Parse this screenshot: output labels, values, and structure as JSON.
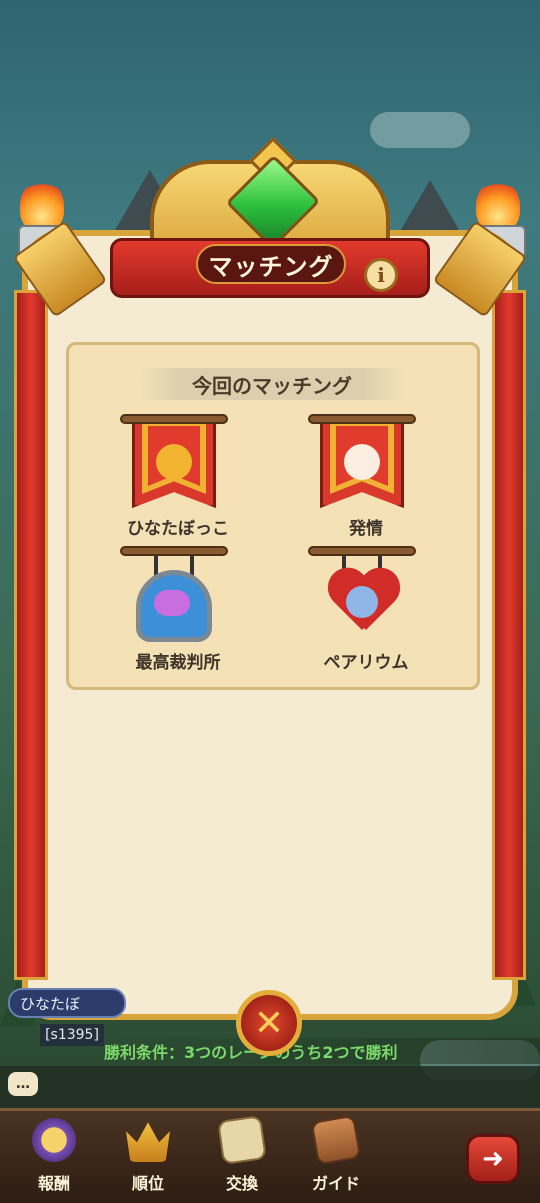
{
  "header": {
    "title": "マッチング",
    "info_icon": "i"
  },
  "card": {
    "subtitle": "今回のマッチング",
    "teams": [
      {
        "name": "ひなたぼっこ",
        "icon": "mushroom-banner-icon"
      },
      {
        "name": "発情",
        "icon": "lion-banner-icon"
      },
      {
        "name": "最高裁判所",
        "icon": "cat-shield-icon"
      },
      {
        "name": "ペアリウム",
        "icon": "heart-portrait-icon"
      }
    ]
  },
  "close_button": {
    "label": "✕"
  },
  "bottom_info": {
    "ally_tag": "ひなたぼ",
    "server": "[s1395]",
    "win_condition": "勝利条件：3つのレーンのうち2つで勝利"
  },
  "chat": {
    "icon_label": "…"
  },
  "nav": {
    "items": [
      {
        "label": "報酬",
        "icon": "medal-icon"
      },
      {
        "label": "順位",
        "icon": "crown-icon"
      },
      {
        "label": "交換",
        "icon": "ticket-icon"
      },
      {
        "label": "ガイド",
        "icon": "guide-icon"
      }
    ],
    "exit_icon": "exit-icon"
  },
  "colors": {
    "accent_red": "#d8392a",
    "gold": "#d9a43a",
    "win_green": "#7cd86a"
  }
}
